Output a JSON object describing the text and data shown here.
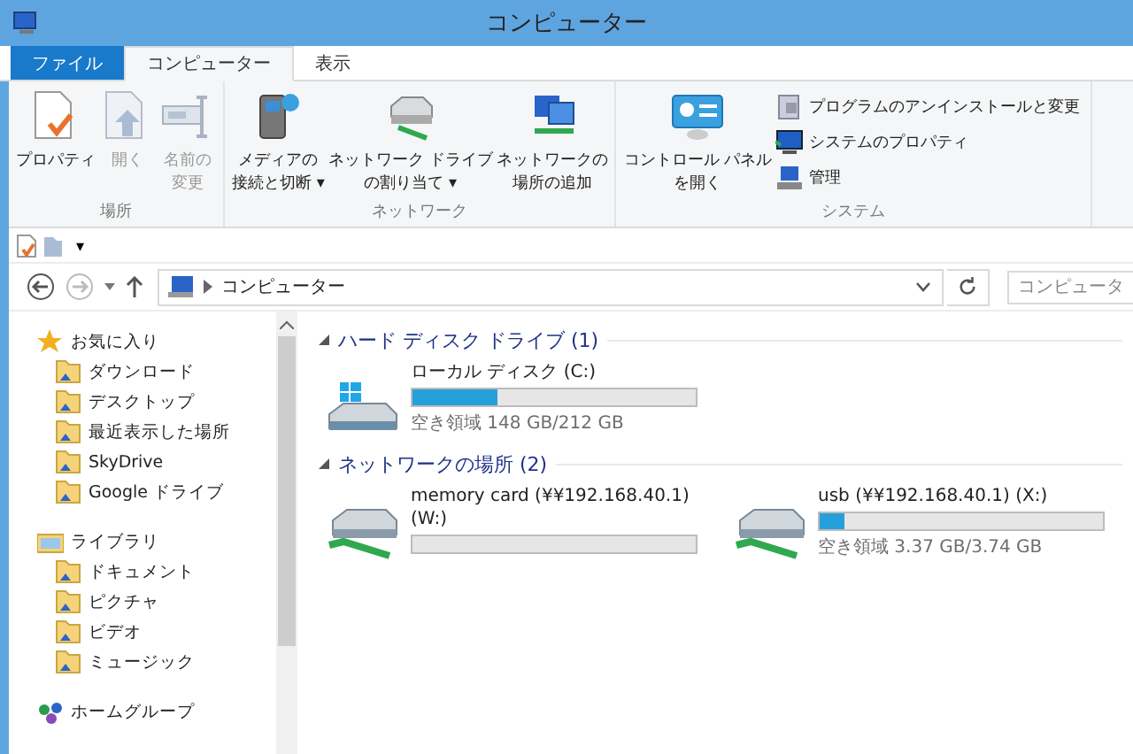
{
  "window": {
    "title": "コンピューター"
  },
  "tabs": [
    {
      "label": "ファイル",
      "kind": "file",
      "selected": false
    },
    {
      "label": "コンピューター",
      "kind": "tab",
      "selected": true
    },
    {
      "label": "表示",
      "kind": "tab",
      "selected": false
    }
  ],
  "ribbon": {
    "groups": [
      {
        "label": "場所",
        "items": [
          {
            "kind": "large",
            "label": "プロパティ",
            "disabled": false
          },
          {
            "kind": "large",
            "label": "開く",
            "disabled": true
          },
          {
            "kind": "large",
            "lines": [
              "名前の",
              "変更"
            ],
            "disabled": true
          }
        ]
      },
      {
        "label": "ネットワーク",
        "items": [
          {
            "kind": "large",
            "lines": [
              "メディアの",
              "接続と切断 ▾"
            ],
            "disabled": false
          },
          {
            "kind": "large",
            "lines": [
              "ネットワーク ドライブ",
              "の割り当て ▾"
            ],
            "disabled": false
          },
          {
            "kind": "large",
            "lines": [
              "ネットワークの",
              "場所の追加"
            ],
            "disabled": false
          }
        ]
      },
      {
        "label": "システム",
        "items": [
          {
            "kind": "large",
            "lines": [
              "コントロール パネル",
              "を開く"
            ],
            "disabled": false
          },
          {
            "kind": "small",
            "label": "プログラムのアンインストールと変更",
            "disabled": false
          },
          {
            "kind": "small",
            "label": "システムのプロパティ",
            "disabled": false
          },
          {
            "kind": "small",
            "label": "管理",
            "disabled": false
          }
        ]
      }
    ]
  },
  "quick_access": {
    "dropdown": "▾"
  },
  "address_bar": {
    "path": "コンピューター",
    "search_placeholder": "コンピュータ"
  },
  "sidebar": {
    "items": [
      {
        "label": "お気に入り",
        "children": [
          {
            "label": "ダウンロード"
          },
          {
            "label": "デスクトップ"
          },
          {
            "label": "最近表示した場所"
          },
          {
            "label": "SkyDrive"
          },
          {
            "label": "Google ドライブ"
          }
        ]
      },
      {
        "label": "ライブラリ",
        "children": [
          {
            "label": "ドキュメント"
          },
          {
            "label": "ピクチャ"
          },
          {
            "label": "ビデオ"
          },
          {
            "label": "ミュージック"
          }
        ]
      },
      {
        "label": "ホームグループ"
      }
    ]
  },
  "sections": [
    {
      "title": "ハード ディスク ドライブ (1)",
      "expanded": true,
      "drives": [
        {
          "kind": "local",
          "name": "ローカル ディスク (C:)",
          "level": 0.3,
          "free": "空き領域 148 GB/212 GB"
        }
      ]
    },
    {
      "title": "ネットワークの場所 (2)",
      "expanded": true,
      "drives": [
        {
          "kind": "network",
          "name": "memory card (¥¥192.168.40.1)\n(W:)",
          "level": 0
        },
        {
          "kind": "network",
          "name": "usb (¥¥192.168.40.1) (X:)",
          "level": 0.09,
          "free": "空き領域 3.37 GB/3.74 GB"
        }
      ]
    }
  ]
}
